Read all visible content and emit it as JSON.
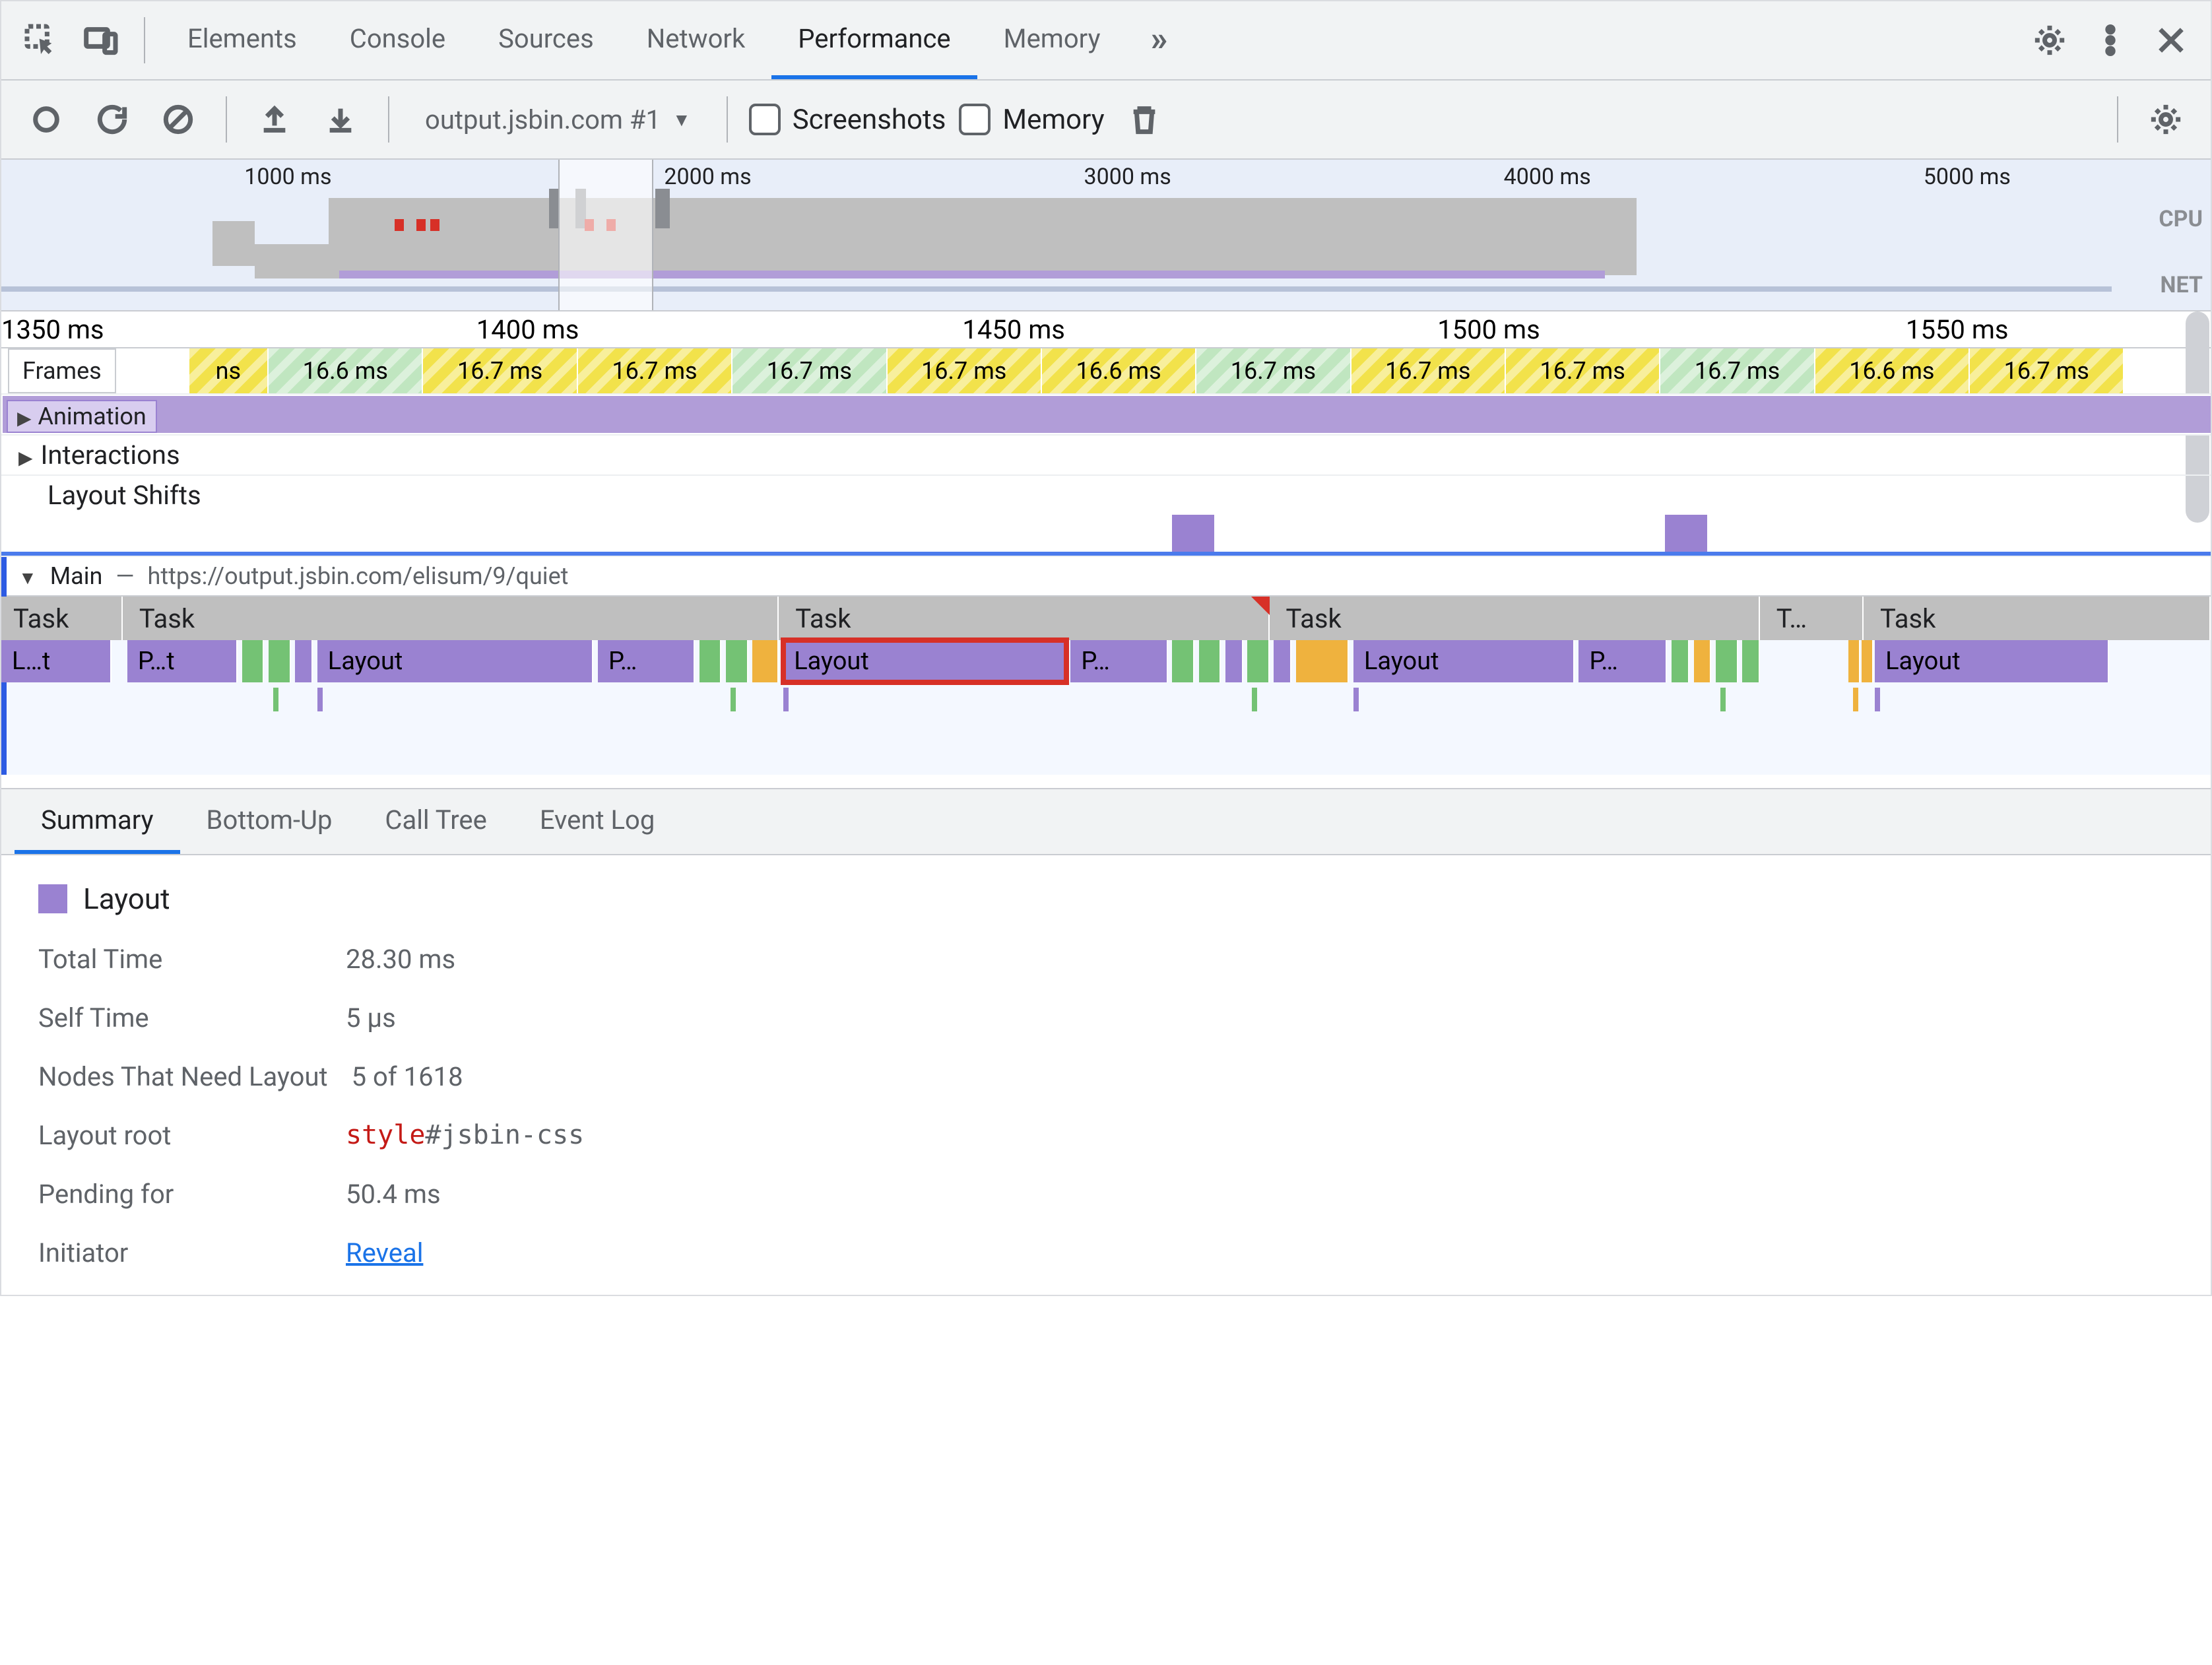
{
  "tabs": {
    "items": [
      "Elements",
      "Console",
      "Sources",
      "Network",
      "Performance",
      "Memory"
    ],
    "active": 4,
    "overflow_glyph": "»"
  },
  "controls": {
    "profile_select": "output.jsbin.com #1",
    "screenshots_label": "Screenshots",
    "screenshots_checked": false,
    "memory_label": "Memory",
    "memory_checked": false
  },
  "overview": {
    "ruler_ticks": [
      "1000 ms",
      "2000 ms",
      "3000 ms",
      "4000 ms",
      "5000 ms"
    ],
    "labels": [
      "CPU",
      "NET"
    ],
    "selection_pct": {
      "left": 25.2,
      "width": 4.3
    }
  },
  "timeline": {
    "ruler_ticks": [
      "1350 ms",
      "1400 ms",
      "1450 ms",
      "1500 ms",
      "1550 ms"
    ],
    "frames": {
      "label": "Frames",
      "cells": [
        {
          "txt": "ns",
          "w": 3.6,
          "slow": true
        },
        {
          "txt": "16.6 ms",
          "w": 7.0,
          "slow": false
        },
        {
          "txt": "16.7 ms",
          "w": 7.0,
          "slow": true
        },
        {
          "txt": "16.7 ms",
          "w": 7.0,
          "slow": true
        },
        {
          "txt": "16.7 ms",
          "w": 7.0,
          "slow": false
        },
        {
          "txt": "16.7 ms",
          "w": 7.0,
          "slow": true
        },
        {
          "txt": "16.6 ms",
          "w": 7.0,
          "slow": true
        },
        {
          "txt": "16.7 ms",
          "w": 7.0,
          "slow": false
        },
        {
          "txt": "16.7 ms",
          "w": 7.0,
          "slow": true
        },
        {
          "txt": "16.7 ms",
          "w": 7.0,
          "slow": true
        },
        {
          "txt": "16.7 ms",
          "w": 7.0,
          "slow": false
        },
        {
          "txt": "16.6 ms",
          "w": 7.0,
          "slow": true
        },
        {
          "txt": "16.7 ms",
          "w": 7.0,
          "slow": true
        }
      ]
    },
    "animation_label": "Animation",
    "interactions_label": "Interactions",
    "layout_shifts_label": "Layout Shifts",
    "layout_shifts_pos_pct": [
      53.0,
      75.3
    ],
    "main": {
      "label": "Main",
      "separator": "—",
      "url": "https://output.jsbin.com/elisum/9/quiet",
      "task_label": "Task",
      "task_truncated": "T…",
      "tasks_pct": [
        {
          "l": 0,
          "w": 5.5,
          "txt": "Task"
        },
        {
          "l": 5.7,
          "w": 29.5,
          "txt": "Task"
        },
        {
          "l": 35.4,
          "w": 22.0,
          "txt": "Task",
          "flag": true
        },
        {
          "l": 57.6,
          "w": 22.0,
          "txt": "Task"
        },
        {
          "l": 79.8,
          "w": 4.5,
          "txt": "T…"
        },
        {
          "l": 84.5,
          "w": 15.5,
          "txt": "Task"
        }
      ],
      "flame_pct": [
        {
          "l": 0,
          "w": 5.0,
          "txt": "L…t",
          "c": "purple"
        },
        {
          "l": 5.7,
          "w": 5.0,
          "txt": "P…t",
          "c": "purple"
        },
        {
          "l": 10.9,
          "w": 1.0,
          "txt": "",
          "c": "green"
        },
        {
          "l": 12.1,
          "w": 1.0,
          "txt": "",
          "c": "green"
        },
        {
          "l": 13.3,
          "w": 0.8,
          "txt": "",
          "c": "purple"
        },
        {
          "l": 14.3,
          "w": 12.5,
          "txt": "Layout",
          "c": "purple"
        },
        {
          "l": 27.0,
          "w": 4.4,
          "txt": "P…",
          "c": "purple"
        },
        {
          "l": 31.6,
          "w": 1.0,
          "txt": "",
          "c": "green"
        },
        {
          "l": 32.8,
          "w": 1.0,
          "txt": "",
          "c": "green"
        },
        {
          "l": 34.0,
          "w": 1.2,
          "txt": "",
          "c": "orange"
        },
        {
          "l": 35.4,
          "w": 12.8,
          "txt": "Layout",
          "c": "purple",
          "hl": true
        },
        {
          "l": 48.4,
          "w": 4.4,
          "txt": "P…",
          "c": "purple"
        },
        {
          "l": 53.0,
          "w": 1.0,
          "txt": "",
          "c": "green"
        },
        {
          "l": 54.2,
          "w": 1.0,
          "txt": "",
          "c": "green"
        },
        {
          "l": 55.4,
          "w": 0.8,
          "txt": "",
          "c": "purple"
        },
        {
          "l": 56.4,
          "w": 1.0,
          "txt": "",
          "c": "green"
        },
        {
          "l": 57.6,
          "w": 0.8,
          "txt": "",
          "c": "purple"
        },
        {
          "l": 58.6,
          "w": 2.4,
          "txt": "",
          "c": "orange"
        },
        {
          "l": 61.2,
          "w": 10.0,
          "txt": "Layout",
          "c": "purple"
        },
        {
          "l": 71.4,
          "w": 4.0,
          "txt": "P…",
          "c": "purple"
        },
        {
          "l": 75.6,
          "w": 0.8,
          "txt": "",
          "c": "green"
        },
        {
          "l": 76.6,
          "w": 0.8,
          "txt": "",
          "c": "orange"
        },
        {
          "l": 77.6,
          "w": 1.0,
          "txt": "",
          "c": "green"
        },
        {
          "l": 78.8,
          "w": 0.8,
          "txt": "",
          "c": "green"
        },
        {
          "l": 83.6,
          "w": 0.4,
          "txt": "",
          "c": "orange"
        },
        {
          "l": 84.2,
          "w": 0.4,
          "txt": "",
          "c": "orange"
        },
        {
          "l": 84.8,
          "w": 10.6,
          "txt": "Layout",
          "c": "purple"
        }
      ]
    }
  },
  "details": {
    "tabs": [
      "Summary",
      "Bottom-Up",
      "Call Tree",
      "Event Log"
    ],
    "active": 0,
    "title": "Layout",
    "rows": {
      "total_time": {
        "k": "Total Time",
        "v": "28.30 ms"
      },
      "self_time": {
        "k": "Self Time",
        "v": "5 µs"
      },
      "nodes": {
        "k": "Nodes That Need Layout",
        "v": "5 of 1618"
      },
      "root": {
        "k": "Layout root",
        "tag": "style",
        "sel": "#jsbin-css"
      },
      "pending": {
        "k": "Pending for",
        "v": "50.4 ms"
      },
      "initiator": {
        "k": "Initiator",
        "link": "Reveal"
      }
    }
  }
}
